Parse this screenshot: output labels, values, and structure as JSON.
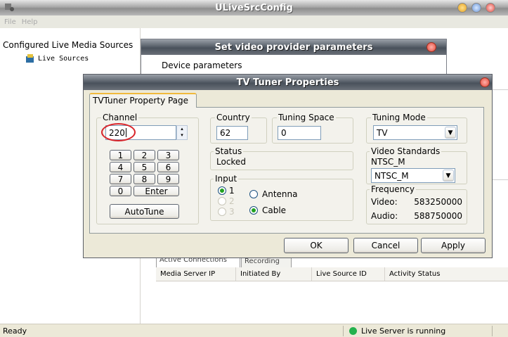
{
  "main_window": {
    "title": "ULiveSrcConfig",
    "menu": [
      "File",
      "Help"
    ],
    "tree_header": "Configured Live Media Sources",
    "tree_item": "Live Sources",
    "tabs": [
      "Active Connections",
      "Recording"
    ],
    "columns": [
      "Media Server IP",
      "Initiated By",
      "Live Source ID",
      "Activity Status"
    ],
    "status_left": "Ready",
    "status_right": "Live Server is running"
  },
  "provider_dialog": {
    "title": "Set video provider parameters",
    "section": "Device parameters"
  },
  "tuner_dialog": {
    "title": "TV Tuner Properties",
    "tab": "TVTuner Property Page",
    "channel": {
      "label": "Channel",
      "value": "220",
      "keys": [
        "1",
        "2",
        "3",
        "4",
        "5",
        "6",
        "7",
        "8",
        "9",
        "0",
        "Enter"
      ],
      "autotune": "AutoTune"
    },
    "country": {
      "label": "Country",
      "value": "62"
    },
    "tuning_space": {
      "label": "Tuning Space",
      "value": "0"
    },
    "tuning_mode": {
      "label": "Tuning Mode",
      "value": "TV"
    },
    "status": {
      "label": "Status",
      "value": "Locked"
    },
    "video_standards": {
      "label": "Video Standards",
      "current": "NTSC_M",
      "selected": "NTSC_M"
    },
    "input": {
      "label": "Input",
      "options": [
        {
          "num": "1",
          "selected": true,
          "disabled": false
        },
        {
          "num": "2",
          "selected": false,
          "disabled": true
        },
        {
          "num": "3",
          "selected": false,
          "disabled": true
        }
      ],
      "antenna": "Antenna",
      "cable": "Cable",
      "cable_selected": true
    },
    "frequency": {
      "label": "Frequency",
      "video_label": "Video:",
      "video_value": "583250000",
      "audio_label": "Audio:",
      "audio_value": "588750000"
    },
    "ok": "OK",
    "cancel": "Cancel",
    "apply": "Apply"
  },
  "colors": {
    "highlight_circle": "#d9252b",
    "status_led": "#23b14d",
    "close_button": "#e2473a"
  }
}
